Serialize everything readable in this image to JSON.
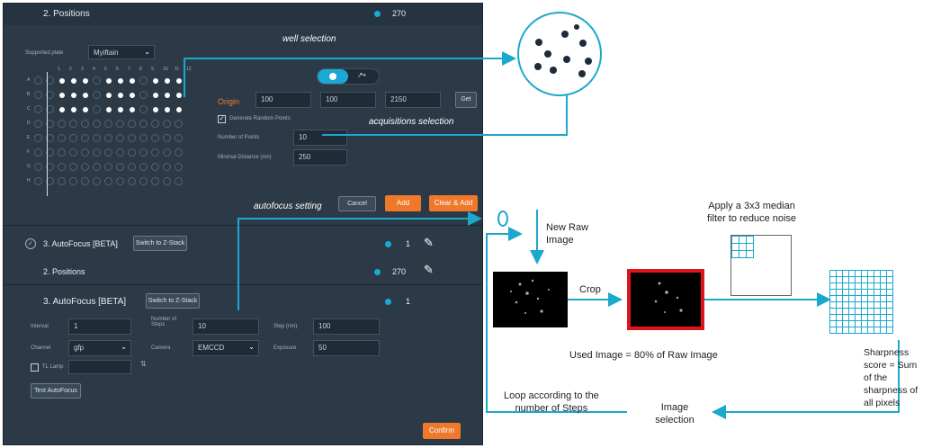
{
  "panel": {
    "positions_title": "2. Positions",
    "positions_count": "270",
    "supported_plate_label": "Supported plate",
    "supported_plate_value": "Myiftain",
    "well_columns": [
      "1",
      "2",
      "3",
      "4",
      "5",
      "6",
      "7",
      "8",
      "9",
      "10",
      "11",
      "12"
    ],
    "well_rows": [
      "A",
      "B",
      "C",
      "D",
      "E",
      "F",
      "G",
      "H"
    ],
    "origin_label": "Origin",
    "origin_values": [
      "100",
      "100",
      "2150"
    ],
    "get_label": "Get",
    "generate_random_label": "Generate Random Points",
    "number_points_label": "Number of Points",
    "number_points_value": "10",
    "minimal_distance_label": "Minimal Distance (nm)",
    "minimal_distance_value": "250",
    "cancel_label": "Cancel",
    "add_label": "Add",
    "clear_add_label": "Clear & Add",
    "af_collapsed_title": "3. AutoFocus [BETA]",
    "switch_zstack_label": "Switch to Z-Stack",
    "af_collapsed_count": "1",
    "positions2_title": "2. Positions",
    "positions2_count": "270",
    "af_title": "3. AutoFocus [BETA]",
    "switch_zstack2_label": "Switch to Z-Stack",
    "af_count": "1",
    "interval_label": "Interval",
    "interval_value": "1",
    "num_steps_label": "Number of Steps",
    "num_steps_value": "10",
    "step_label": "Step (nm)",
    "step_value": "100",
    "channel_label": "Channel",
    "channel_value": "gfp",
    "camera_label": "Camera",
    "camera_value": "EMCCD",
    "exposure_label": "Exposure",
    "exposure_value": "50",
    "tl_lamp_label": "TL Lamp",
    "test_af_label": "Test AutoFocus",
    "confirm_label": "Confirm"
  },
  "annotations": {
    "well_selection": "well selection",
    "acquisitions_selection": "acquisitions selection",
    "autofocus_setting": "autofocus setting"
  },
  "diagram": {
    "new_raw_image": "New Raw\nImage",
    "crop": "Crop",
    "median_filter": "Apply a 3x3 median\nfilter to reduce noise",
    "used_image": "Used Image = 80% of Raw Image",
    "sharpness": "Sharpness\nscore = Sum\nof the\nsharpness of\nall pixels",
    "image_selection": "Image\nselection",
    "loop": "Loop according to the\nnumber of Steps"
  },
  "colors": {
    "panel_bg": "#2c3a47",
    "accent_cyan": "#19a9d4",
    "orange": "#f0782a",
    "crop_red": "#e0141b"
  }
}
